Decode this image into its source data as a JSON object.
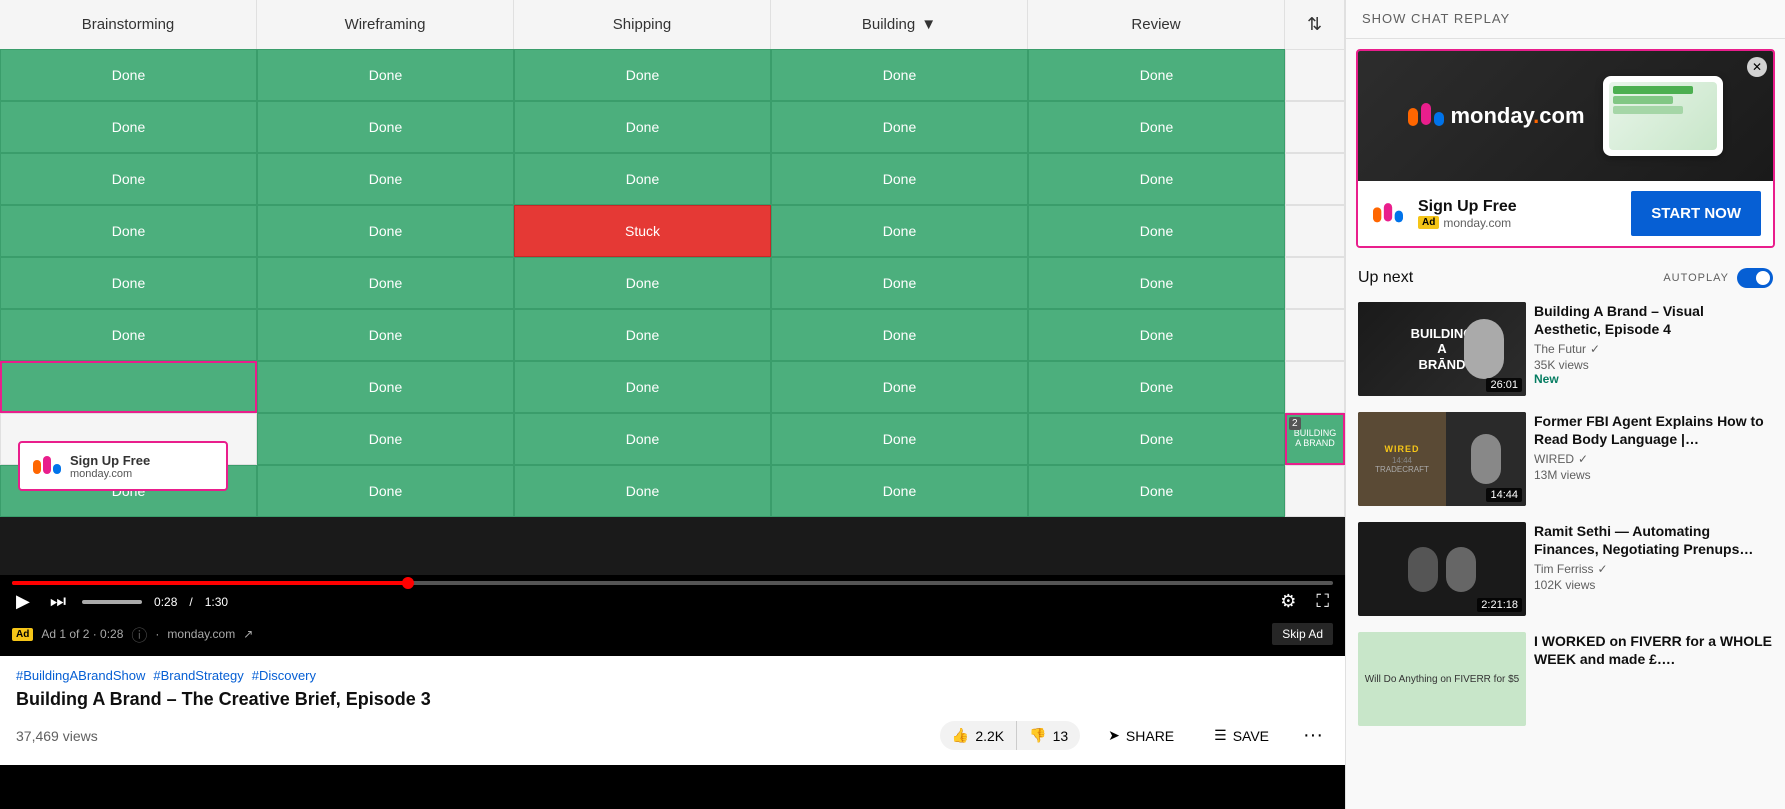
{
  "header": {
    "chat_replay_btn": "SHOW CHAT REPLAY"
  },
  "kanban": {
    "columns": [
      "Brainstorming",
      "Wireframing",
      "Shipping",
      "Building",
      "Review"
    ],
    "sort_icon": "⇅",
    "rows": [
      [
        "Done",
        "Done",
        "Done",
        "Done",
        "Done"
      ],
      [
        "Done",
        "Done",
        "Done",
        "Done",
        "Done"
      ],
      [
        "Done",
        "Done",
        "Done",
        "Done",
        "Done"
      ],
      [
        "Done",
        "Done",
        "Stuck",
        "Done",
        "Done"
      ],
      [
        "Done",
        "Done",
        "Done",
        "Done",
        "Done"
      ],
      [
        "Done",
        "Done",
        "Done",
        "Done",
        "Done"
      ],
      [
        "",
        "Done",
        "Done",
        "Done",
        "Done"
      ],
      [
        "",
        "Done",
        "Done",
        "Done",
        "Done"
      ],
      [
        "Done",
        "Done",
        "Done",
        "Done",
        "Done"
      ]
    ]
  },
  "ad_overlay": {
    "title": "Sign Up Free",
    "domain": "monday.com",
    "counter": "Ad 1 of 2",
    "time": "0:28"
  },
  "video_controls": {
    "time_current": "0:28",
    "time_total": "1:30",
    "progress_percent": 30
  },
  "ad_bar": {
    "label": "Ad",
    "counter": "Ad 1 of 2 · 0:28",
    "domain": "monday.com",
    "skip_label": "Skip Ad"
  },
  "below_video": {
    "tags": [
      "#BuildingABrandShow",
      "#BrandStrategy",
      "#Discovery"
    ],
    "title": "Building A Brand – The Creative Brief, Episode 3",
    "views": "37,469 views",
    "like_count": "2.2K",
    "dislike_count": "13",
    "share_label": "SHARE",
    "save_label": "SAVE"
  },
  "sidebar_ad": {
    "title": "Sign Up Free",
    "ad_label": "Ad",
    "domain": "monday.com",
    "start_btn": "START NOW",
    "logo_text": "monday",
    "logo_dot": ".com"
  },
  "up_next": {
    "label": "Up next",
    "autoplay_label": "AUTOPLAY"
  },
  "videos": [
    {
      "title": "Building A Brand – Visual Aesthetic, Episode 4",
      "channel": "The Futur",
      "verified": true,
      "views": "35K views",
      "badge": "New",
      "duration": "26:01",
      "thumb_type": "building"
    },
    {
      "title": "Former FBI Agent Explains How to Read Body Language |…",
      "channel": "WIRED",
      "verified": true,
      "views": "13M views",
      "badge": "",
      "duration": "14:44",
      "thumb_type": "wired"
    },
    {
      "title": "Ramit Sethi — Automating Finances, Negotiating Prenups…",
      "channel": "Tim Ferriss",
      "verified": true,
      "views": "102K views",
      "badge": "",
      "duration": "2:21:18",
      "thumb_type": "ramit"
    },
    {
      "title": "I WORKED on FIVERR for a WHOLE WEEK and made £….",
      "channel": "",
      "verified": false,
      "views": "",
      "badge": "",
      "duration": "",
      "thumb_type": "fiverr"
    }
  ]
}
